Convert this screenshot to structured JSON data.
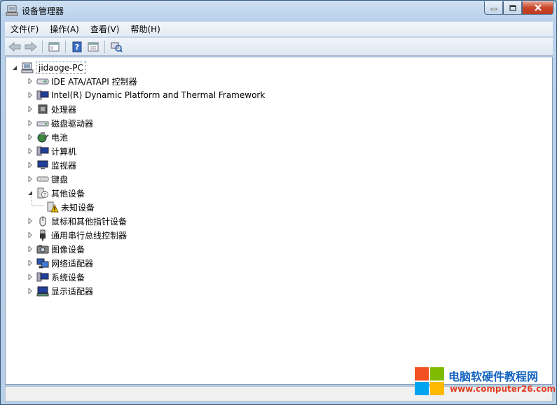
{
  "window": {
    "title": "设备管理器"
  },
  "menubar": {
    "items": [
      "文件(F)",
      "操作(A)",
      "查看(V)",
      "帮助(H)"
    ]
  },
  "toolbar": {
    "icons": [
      "back-arrow-icon",
      "forward-arrow-icon",
      "show-hide-tree-icon",
      "help-icon",
      "properties-icon",
      "scan-hardware-icon"
    ]
  },
  "tree": {
    "root": {
      "label": "jidaoge-PC",
      "expanded": true
    },
    "items": [
      {
        "label": "IDE ATA/ATAPI 控制器",
        "icon": "ide-controller-icon"
      },
      {
        "label": "Intel(R) Dynamic Platform and Thermal Framework",
        "icon": "computer-device-icon"
      },
      {
        "label": "处理器",
        "icon": "processor-icon"
      },
      {
        "label": "磁盘驱动器",
        "icon": "disk-drive-icon"
      },
      {
        "label": "电池",
        "icon": "battery-icon"
      },
      {
        "label": "计算机",
        "icon": "computer-icon"
      },
      {
        "label": "监视器",
        "icon": "monitor-icon"
      },
      {
        "label": "键盘",
        "icon": "keyboard-icon"
      },
      {
        "label": "其他设备",
        "icon": "other-devices-icon",
        "expanded": true,
        "children": [
          {
            "label": "未知设备",
            "icon": "unknown-device-warning-icon"
          }
        ]
      },
      {
        "label": "鼠标和其他指针设备",
        "icon": "mouse-icon"
      },
      {
        "label": "通用串行总线控制器",
        "icon": "usb-icon"
      },
      {
        "label": "图像设备",
        "icon": "camera-icon"
      },
      {
        "label": "网络适配器",
        "icon": "network-adapter-icon"
      },
      {
        "label": "系统设备",
        "icon": "system-device-icon"
      },
      {
        "label": "显示适配器",
        "icon": "display-adapter-icon"
      }
    ]
  },
  "watermark": {
    "title": "电脑软硬件教程网",
    "url": "www.computer26.com"
  },
  "colors": {
    "title_blue": "#1565c0",
    "url_red": "#e23b1f",
    "win_red": "#f25022",
    "win_green": "#7fba00",
    "win_blue": "#00a4ef",
    "win_yellow": "#ffb900"
  }
}
